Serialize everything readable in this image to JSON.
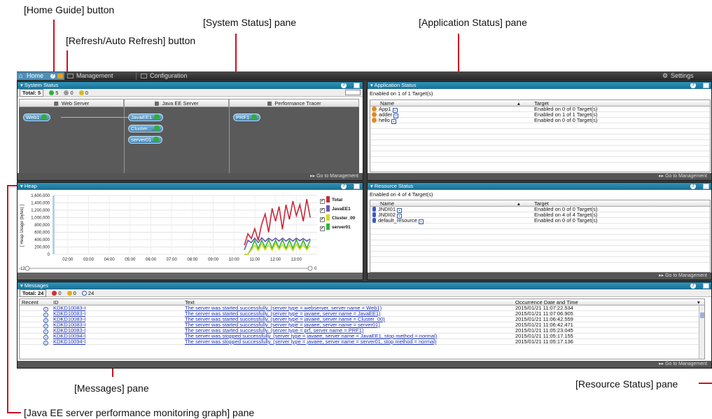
{
  "callouts": {
    "home_guide": "[Home Guide] button",
    "refresh": "[Refresh/Auto Refresh] button",
    "system_status": "[System Status] pane",
    "application_status": "[Application Status] pane",
    "messages": "[Messages] pane",
    "resource_status": "[Resource Status] pane",
    "perf_graph": "[Java EE server performance monitoring graph] pane"
  },
  "topbar": {
    "home": "Home",
    "management": "Management",
    "configuration": "Configuration",
    "settings": "Settings"
  },
  "system_status": {
    "title": "System Status",
    "total_label": "Total: 5",
    "ok_count": "5",
    "gray_count": "0",
    "warn_count": "0",
    "columns": [
      "Web Server",
      "Java EE Server",
      "Performance Tracer"
    ],
    "web_nodes": [
      "Web1"
    ],
    "javaee_nodes": [
      "JavaEE1",
      "Cluster...",
      "server01"
    ],
    "tracer_nodes": [
      "PRF1"
    ],
    "footer": "Go to Management"
  },
  "application_status": {
    "title": "Application Status",
    "enabled_text": "Enabled on 1 of 1 Target(s)",
    "col_name": "Name",
    "col_target": "Target",
    "rows": [
      {
        "name": "App1",
        "target": "Enabled on 0 of 0 Target(s)"
      },
      {
        "name": "adder",
        "target": "Enabled on 1 of 1 Target(s)"
      },
      {
        "name": "hello",
        "target": "Enabled on 0 of 0 Target(s)"
      }
    ],
    "footer": "Go to Management"
  },
  "heap": {
    "title": "Heap",
    "yaxis_label": "[ Heap Usage (bytes) ]",
    "left_marker": "-12",
    "right_marker": "0"
  },
  "chart_data": {
    "type": "line",
    "title": "Heap",
    "ylabel": "[ Heap Usage (bytes) ]",
    "ylim": [
      0,
      1600000
    ],
    "yticks": [
      "1,600,000",
      "1,400,000",
      "1,200,000",
      "1,000,000",
      "800,000",
      "600,000",
      "400,000",
      "200,000",
      "0"
    ],
    "xticks": [
      "02:00",
      "03:00",
      "04:00",
      "05:00",
      "06:00",
      "07:00",
      "08:00",
      "09:00",
      "10:00",
      "11:00",
      "12:00",
      "13:00"
    ],
    "x": [
      "10:30",
      "10:40",
      "10:50",
      "11:00",
      "11:10",
      "11:20",
      "11:30",
      "11:40",
      "11:50",
      "12:00",
      "12:10",
      "12:20",
      "12:30",
      "12:40",
      "12:50",
      "13:00",
      "13:10",
      "13:20",
      "13:30",
      "13:40"
    ],
    "series": [
      {
        "name": "Total",
        "color": "#c8293b",
        "values": [
          250000,
          560000,
          430000,
          700000,
          380000,
          820000,
          1100000,
          600000,
          1250000,
          900000,
          1300000,
          680000,
          1350000,
          950000,
          1450000,
          1050000,
          1350000,
          900000,
          1500000,
          1000000
        ]
      },
      {
        "name": "JavaEE1",
        "color": "#6a58b8",
        "values": [
          120000,
          380000,
          320000,
          440000,
          320000,
          450000,
          350000,
          440000,
          370000,
          440000,
          360000,
          440000,
          360000,
          430000,
          360000,
          440000,
          370000,
          430000,
          360000,
          420000
        ]
      },
      {
        "name": "Cluster_00",
        "color": "#d8d81c",
        "values": [
          0,
          0,
          120000,
          250000,
          100000,
          280000,
          120000,
          260000,
          110000,
          300000,
          130000,
          260000,
          120000,
          250000,
          100000,
          280000,
          130000,
          260000,
          120000,
          240000
        ]
      },
      {
        "name": "server01",
        "color": "#2db63a",
        "values": [
          0,
          0,
          160000,
          380000,
          150000,
          380000,
          180000,
          400000,
          160000,
          380000,
          170000,
          400000,
          150000,
          380000,
          160000,
          400000,
          170000,
          380000,
          160000,
          390000
        ]
      }
    ],
    "grid": true,
    "legend": "right"
  },
  "resource_status": {
    "title": "Resource Status",
    "enabled_text": "Enabled on 4 of 4 Target(s)",
    "col_name": "Name",
    "col_target": "Target",
    "rows": [
      {
        "name": "JNDI01",
        "target": "Enabled on 0 of 0 Target(s)"
      },
      {
        "name": "JNDI02",
        "target": "Enabled on 4 of 4 Target(s)"
      },
      {
        "name": "default_resource",
        "target": "Enabled on 0 of 0 Target(s)"
      }
    ],
    "footer": "Go to Management"
  },
  "messages": {
    "title": "Messages",
    "total_label": "Total: 24",
    "error_count": "0",
    "warn_count": "0",
    "info_count": "24",
    "col_recent": "Recent",
    "col_id": "ID",
    "col_text": "Text",
    "col_time": "Occurrence Date and Time",
    "rows": [
      {
        "id": "KDKD10083-I",
        "text": "The server was started successfully. (server type = webserver, server name = Web1)",
        "time": "2015/01/21 11:07:22.534"
      },
      {
        "id": "KDKD10083-I",
        "text": "The server was started successfully. (server type = javaee, server name = JavaEE1)",
        "time": "2015/01/21 11:07:06.905"
      },
      {
        "id": "KDKD10083-I",
        "text": "The server was started successfully. (server type = javaee, server name = Cluster_00)",
        "time": "2015/01/21 11:06:42.559"
      },
      {
        "id": "KDKD10083-I",
        "text": "The server was started successfully. (server type = javaee, server name = server01)",
        "time": "2015/01/21 11:06:42.471"
      },
      {
        "id": "KDKD10083-I",
        "text": "The server was started successfully. (server type = prf, server name = PRF1)",
        "time": "2015/01/21 11:05:23.045"
      },
      {
        "id": "KDKD10094-I",
        "text": "The server was stopped successfully. (server type = javaee, server name = JavaEE1, stop method = normal)",
        "time": "2015/01/21 11:05:17.155"
      },
      {
        "id": "KDKD10094-I",
        "text": "The server was stopped successfully. (server type = javaee, server name = server01, stop method = normal)",
        "time": "2015/01/21 11:05:17.136"
      }
    ],
    "footer": "Go to Management"
  },
  "colors": {
    "accent": "#1a6f94",
    "callout_line": "#cc1122",
    "ok": "#2fae3a",
    "error": "#d23030",
    "warning": "#e0b020"
  }
}
